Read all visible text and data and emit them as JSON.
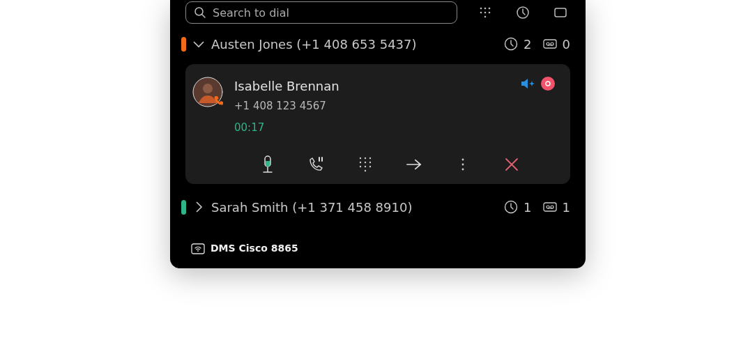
{
  "search": {
    "placeholder": "Search to dial"
  },
  "lines": [
    {
      "label": "Austen Jones (+1 408 653 5437)",
      "color": "#f26b1d",
      "expanded": true,
      "recent_count": "2",
      "voicemail_count": "0",
      "calls": [
        {
          "name": "Isabelle Brennan",
          "number": "+1 408 123 4567",
          "duration": "00:17"
        }
      ]
    },
    {
      "label": "Sarah Smith (+1 371 458 8910)",
      "color": "#2fb58a",
      "expanded": false,
      "recent_count": "1",
      "voicemail_count": "1"
    }
  ],
  "device": {
    "label": "DMS Cisco 8865"
  }
}
